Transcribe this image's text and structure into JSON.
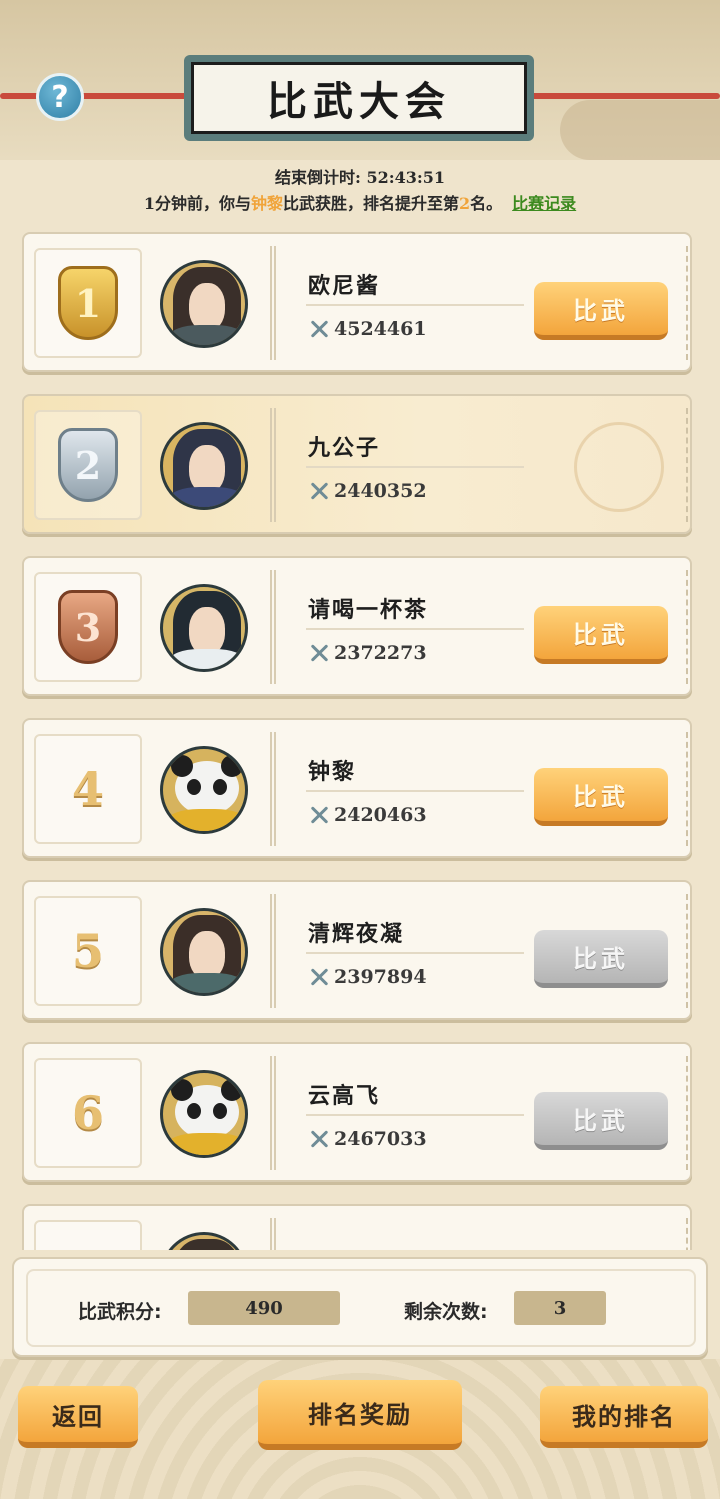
{
  "header": {
    "title": "比武大会",
    "help_icon": "question-mark-icon"
  },
  "countdown": {
    "label": "结束倒计时:",
    "value": "52:43:51"
  },
  "notice": {
    "prefix": "1分钟前，你与",
    "opponent": "钟黎",
    "middle": "比武获胜，排名提升至第",
    "rank": "2",
    "suffix": "名。",
    "link": "比赛记录"
  },
  "ranking": [
    {
      "rank": "1",
      "name": "欧尼酱",
      "power": "4524461",
      "button": "比武",
      "button_state": "active",
      "medal": "gold",
      "avatar": "male-warrior"
    },
    {
      "rank": "2",
      "name": "九公子",
      "power": "2440352",
      "button": "",
      "button_state": "none",
      "medal": "silver",
      "avatar": "male-swordsman"
    },
    {
      "rank": "3",
      "name": "请喝一杯茶",
      "power": "2372273",
      "button": "比武",
      "button_state": "active",
      "medal": "bronze",
      "avatar": "male-scholar"
    },
    {
      "rank": "4",
      "name": "钟黎",
      "power": "2420463",
      "button": "比武",
      "button_state": "active",
      "medal": "",
      "avatar": "panda"
    },
    {
      "rank": "5",
      "name": "清辉夜凝",
      "power": "2397894",
      "button": "比武",
      "button_state": "disabled",
      "medal": "",
      "avatar": "male-warrior"
    },
    {
      "rank": "6",
      "name": "云高飞",
      "power": "2467033",
      "button": "比武",
      "button_state": "disabled",
      "medal": "",
      "avatar": "panda"
    }
  ],
  "stats": {
    "score_label": "比武积分:",
    "score_value": "490",
    "remaining_label": "剩余次数:",
    "remaining_value": "3"
  },
  "buttons": {
    "back": "返回",
    "rewards": "排名奖励",
    "my_rank": "我的排名"
  },
  "colors": {
    "accent_orange": "#f3a53c",
    "highlight_text": "#f0a43a",
    "link_green": "#3c8a1e",
    "background": "#efe4cc"
  }
}
